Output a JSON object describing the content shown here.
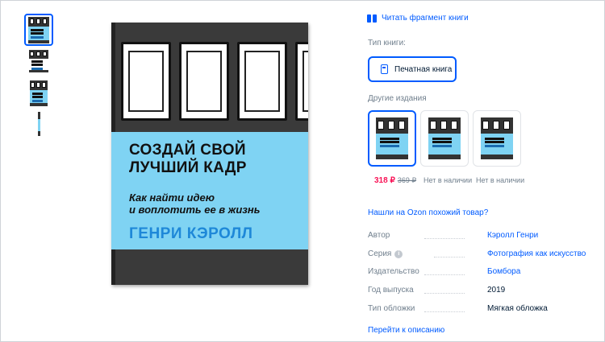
{
  "read_fragment": {
    "icon": "open-book-icon",
    "label": "Читать фрагмент книги"
  },
  "book_type": {
    "label": "Тип книги:",
    "option": "Печатная книга",
    "icon": "document-icon"
  },
  "other_editions": {
    "label": "Другие издания",
    "items": [
      {
        "price": "318 ₽",
        "old_price": "369 ₽",
        "status": ""
      },
      {
        "price": "",
        "old_price": "",
        "status": "Нет в наличии"
      },
      {
        "price": "",
        "old_price": "",
        "status": "Нет в наличии"
      }
    ]
  },
  "similar_link": "Нашли на Ozon похожий товар?",
  "specs": [
    {
      "key": "Автор",
      "value": "Кэролл Генри",
      "link": true
    },
    {
      "key": "Серия",
      "value": "Фотография как искусство",
      "link": true,
      "info": "info-icon"
    },
    {
      "key": "Издательство",
      "value": "Бомбора",
      "link": true
    },
    {
      "key": "Год выпуска",
      "value": "2019",
      "link": false
    },
    {
      "key": "Тип обложки",
      "value": "Мягкая обложка",
      "link": false
    }
  ],
  "goto_description": "Перейти к описанию",
  "cover": {
    "title": "СОЗДАЙ СВОЙ\nЛУЧШИЙ КАДР",
    "subtitle": "Как найти идею\nи воплотить ее в жизнь",
    "author": "ГЕНРИ КЭРОЛЛ",
    "colors": {
      "band": "#7fd3f3",
      "dark": "#3a3a3a",
      "author": "#1e88d8"
    }
  },
  "colors": {
    "accent": "#005bff",
    "price": "#f91155",
    "muted": "#707f8d"
  }
}
